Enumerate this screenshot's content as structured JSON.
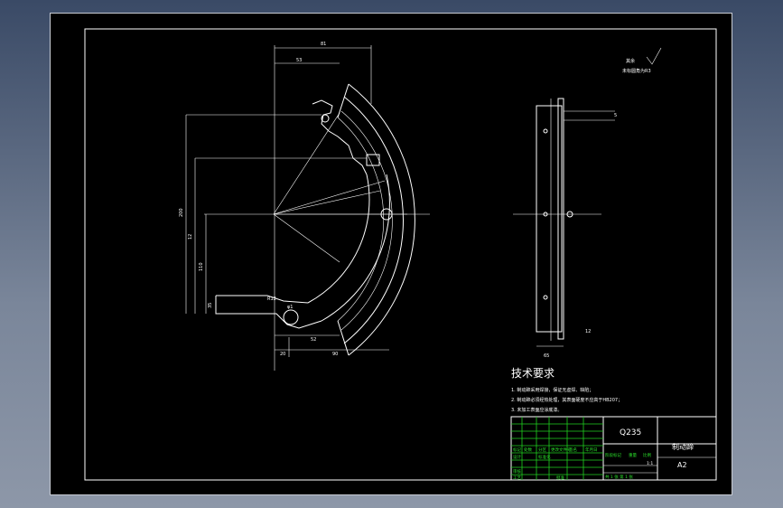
{
  "drawing": {
    "dims": {
      "top_width": "81",
      "top_inner": "53",
      "height_total": "200",
      "height_mid": "12",
      "height_low": "110",
      "left_small": "35",
      "bottom_52": "52",
      "bottom_20": "20",
      "bottom_90": "90",
      "hole_r": "R12",
      "hole_d": "φ1",
      "side_width": "65",
      "side_gap": "12",
      "side_top": "5"
    },
    "roughness_note_1": "其余",
    "roughness_note_2": "未标圆角为R3"
  },
  "tech_requirements": {
    "title": "技术要求",
    "items": [
      "1. 制动蹄采用焊接，保证无虚焊、缺陷；",
      "2. 制动蹄必须经热处理，其表面硬度不应高于HB207；",
      "3. 未加工表面应涂底漆。"
    ]
  },
  "title_block": {
    "material": "Q235",
    "part_name": "制动蹄",
    "drawing_no": "A2",
    "scale": "1:1",
    "sheet": "共 1 张  第 1 张",
    "labels": [
      "标记",
      "处数",
      "分区",
      "更改文件号",
      "签名",
      "年月日",
      "设计",
      "标准化",
      "审核",
      "工艺",
      "批准",
      "阶段标记",
      "重量",
      "比例"
    ]
  },
  "colors": {
    "background": "#000000",
    "lines": "#ffffff",
    "title_text": "#2be02b"
  }
}
